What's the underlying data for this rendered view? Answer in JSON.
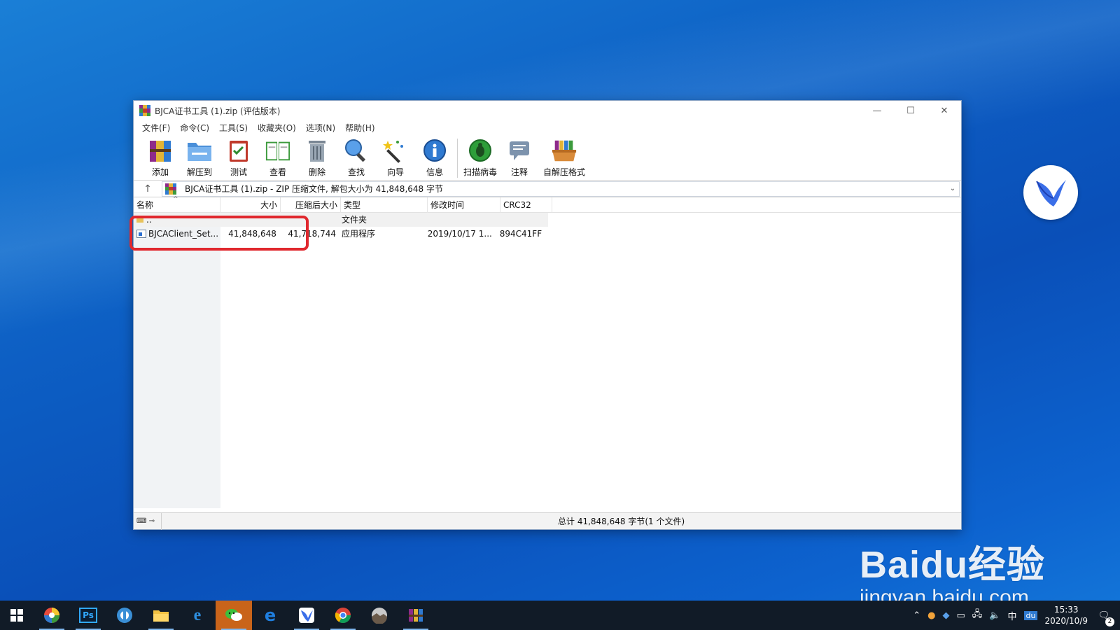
{
  "window": {
    "title": "BJCA证书工具 (1).zip (评估版本)"
  },
  "menu": [
    "文件(F)",
    "命令(C)",
    "工具(S)",
    "收藏夹(O)",
    "选项(N)",
    "帮助(H)"
  ],
  "toolbar": [
    {
      "label": "添加",
      "icon": "add-archive-icon"
    },
    {
      "label": "解压到",
      "icon": "extract-folder-icon"
    },
    {
      "label": "测试",
      "icon": "test-clipboard-icon"
    },
    {
      "label": "查看",
      "icon": "view-book-icon"
    },
    {
      "label": "删除",
      "icon": "trash-icon"
    },
    {
      "label": "查找",
      "icon": "magnifier-icon"
    },
    {
      "label": "向导",
      "icon": "wizard-wand-icon"
    },
    {
      "label": "信息",
      "icon": "info-icon"
    },
    {
      "label": "扫描病毒",
      "icon": "virus-scan-icon"
    },
    {
      "label": "注释",
      "icon": "comment-icon"
    },
    {
      "label": "自解压格式",
      "icon": "sfx-box-icon"
    }
  ],
  "address": {
    "text": "BJCA证书工具 (1).zip - ZIP 压缩文件, 解包大小为 41,848,648 字节"
  },
  "columns": {
    "name": "名称",
    "size": "大小",
    "packed": "压缩后大小",
    "type": "类型",
    "modified": "修改时间",
    "crc": "CRC32"
  },
  "rows": [
    {
      "name": "..",
      "size": "",
      "packed": "",
      "type": "文件夹",
      "modified": "",
      "crc": ""
    },
    {
      "name": "BJCAClient_Set...",
      "size": "41,848,648",
      "packed": "41,718,744",
      "type": "应用程序",
      "modified": "2019/10/17 1...",
      "crc": "894C41FF"
    }
  ],
  "status": {
    "left": "⌨ ⊸",
    "text": "总计 41,848,648 字节(1 个文件)"
  },
  "watermark": {
    "big": "Baidu经验",
    "small": "jingyan.baidu.com"
  },
  "taskbar": {
    "apps": [
      "color-wheel-app-icon",
      "photoshop-icon",
      "browser-sync-icon",
      "file-explorer-icon",
      "ie-icon",
      "wechat-icon",
      "edge-icon",
      "feishu-icon",
      "chrome-icon",
      "landscape-app-icon",
      "winrar-icon"
    ],
    "tray_lang": "中",
    "tray_du": "du",
    "time": "15:33",
    "date": "2020/10/9",
    "notification_count": "2"
  },
  "colors": {
    "highlight": "#e0282e",
    "desktop": "#0d5fc4",
    "taskbar": "#111b27"
  }
}
